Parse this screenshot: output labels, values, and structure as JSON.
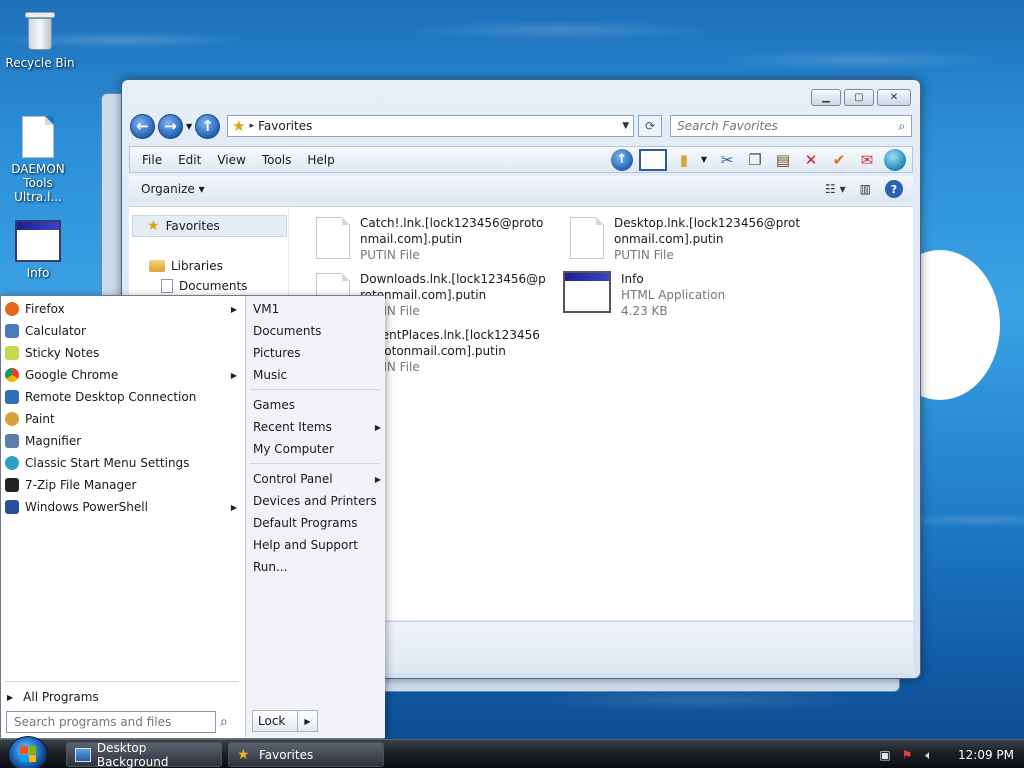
{
  "desktop": {
    "icons": [
      {
        "label": "Recycle Bin"
      },
      {
        "label": "DAEMON Tools Ultra.l..."
      },
      {
        "label": "Info"
      }
    ]
  },
  "explorer": {
    "address": "Favorites",
    "search_placeholder": "Search Favorites",
    "menu": [
      "File",
      "Edit",
      "View",
      "Tools",
      "Help"
    ],
    "organize": "Organize",
    "nav": {
      "favorites": "Favorites",
      "libraries": "Libraries",
      "documents": "Documents"
    },
    "files": [
      {
        "name": "Catch!.lnk.[lock123456@protonmail.com].putin",
        "type": "PUTIN File"
      },
      {
        "name": "Desktop.lnk.[lock123456@protonmail.com].putin",
        "type": "PUTIN File"
      },
      {
        "name": "Downloads.lnk.[lock123456@protonmail.com].putin",
        "type": "PUTIN File"
      },
      {
        "name": "Info",
        "type": "HTML Application",
        "size": "4.23 KB"
      },
      {
        "name": "RecentPlaces.lnk.[lock123456@protonmail.com].putin",
        "type": "PUTIN File"
      }
    ]
  },
  "start_menu": {
    "programs": [
      {
        "label": "Firefox",
        "submenu": true,
        "color": "#e8661a"
      },
      {
        "label": "Calculator",
        "submenu": false,
        "color": "#4a7ab8"
      },
      {
        "label": "Sticky Notes",
        "submenu": false,
        "color": "#c9d84a"
      },
      {
        "label": "Google Chrome",
        "submenu": true,
        "color": "#db4437"
      },
      {
        "label": "Remote Desktop Connection",
        "submenu": false,
        "color": "#2f6fb8"
      },
      {
        "label": "Paint",
        "submenu": false,
        "color": "#d9a13a"
      },
      {
        "label": "Magnifier",
        "submenu": false,
        "color": "#5a7ea8"
      },
      {
        "label": "Classic Start Menu Settings",
        "submenu": false,
        "color": "#2aa0c8"
      },
      {
        "label": "7-Zip File Manager",
        "submenu": false,
        "color": "#222222"
      },
      {
        "label": "Windows PowerShell",
        "submenu": true,
        "color": "#2a4f9a"
      }
    ],
    "all_programs": "All Programs",
    "search_placeholder": "Search programs and files",
    "right_group1": [
      {
        "label": "VM1",
        "submenu": false
      },
      {
        "label": "Documents",
        "submenu": false
      },
      {
        "label": "Pictures",
        "submenu": false
      },
      {
        "label": "Music",
        "submenu": false
      }
    ],
    "right_group2": [
      {
        "label": "Games",
        "submenu": false
      },
      {
        "label": "Recent Items",
        "submenu": true
      },
      {
        "label": "My Computer",
        "submenu": false
      }
    ],
    "right_group3": [
      {
        "label": "Control Panel",
        "submenu": true
      },
      {
        "label": "Devices and Printers",
        "submenu": false
      },
      {
        "label": "Default Programs",
        "submenu": false
      },
      {
        "label": "Help and Support",
        "submenu": false
      },
      {
        "label": "Run...",
        "submenu": false
      }
    ],
    "lock": "Lock"
  },
  "taskbar": {
    "buttons": [
      {
        "label": "Desktop Background"
      },
      {
        "label": "Favorites"
      }
    ],
    "clock": "12:09 PM"
  }
}
